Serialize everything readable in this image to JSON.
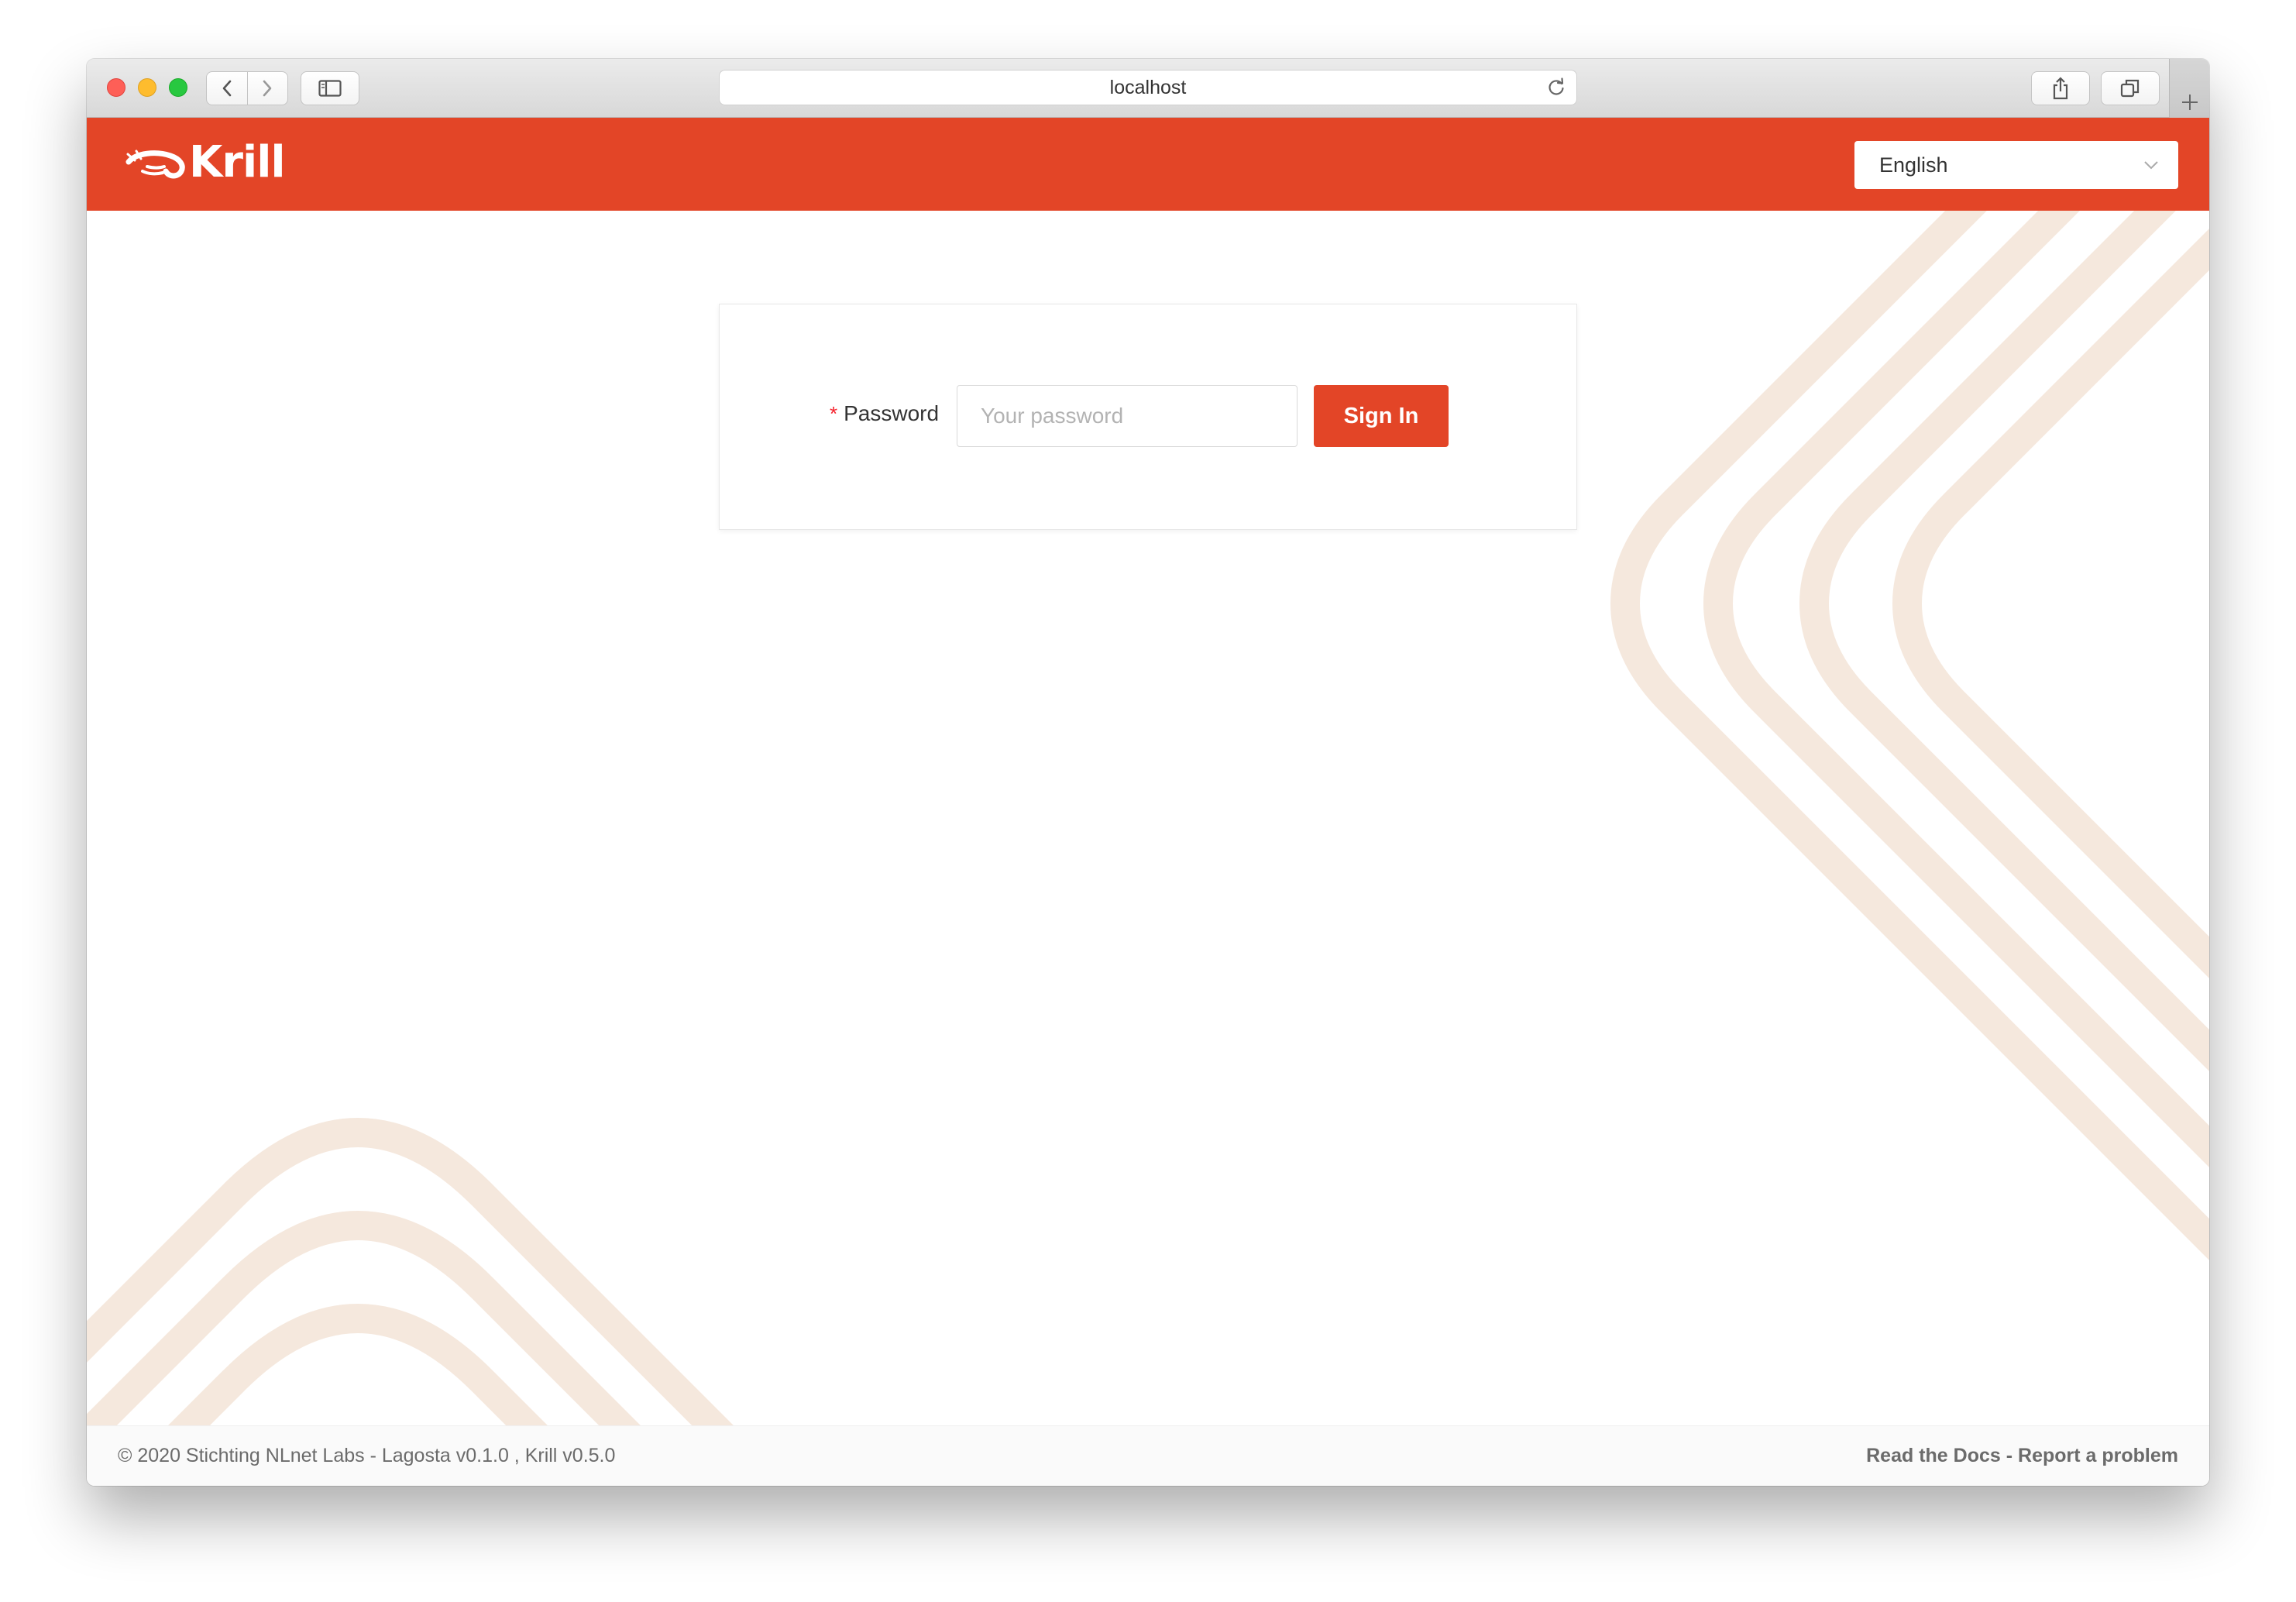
{
  "browser": {
    "url": "localhost"
  },
  "header": {
    "logo_text": "Krill",
    "language": {
      "selected": "English"
    }
  },
  "login": {
    "password_label": "Password",
    "required_marker": "*",
    "password_placeholder": "Your password",
    "password_value": "",
    "submit_label": "Sign In"
  },
  "footer": {
    "copyright": "© 2020 Stichting NLnet Labs - Lagosta v0.1.0 , Krill v0.5.0",
    "links": [
      {
        "label": "Read the Docs"
      },
      {
        "label": "Report a problem"
      }
    ],
    "separator": " - "
  },
  "colors": {
    "brand": "#e34527",
    "decoration": "#f5e8dd"
  }
}
